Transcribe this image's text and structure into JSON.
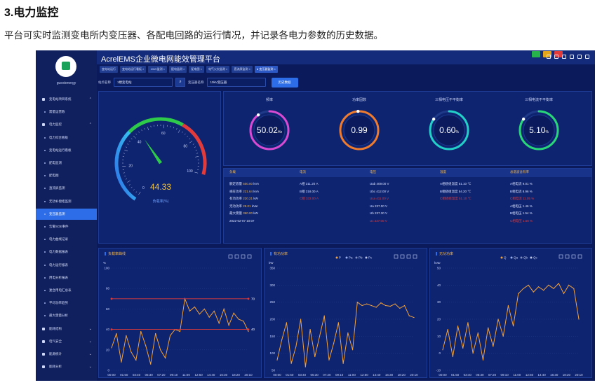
{
  "doc": {
    "title": "3.电力监控",
    "description": "平台可实时监测变电所内变压器、各配电回路的运行情况，并记录各电力参数的历史数据。"
  },
  "app": {
    "title": "AcrelEMS企业微电网能效管理平台",
    "user": "guestenergy"
  },
  "sidebar": [
    {
      "label": "变电站项目系统",
      "level": 1,
      "chevron": "⌃"
    },
    {
      "label": "需量运营数",
      "level": 2
    },
    {
      "label": "电力监控",
      "level": 1,
      "chevron": "⌃"
    },
    {
      "label": "电力综合看板",
      "level": 2
    },
    {
      "label": "变电站运行看板",
      "level": 2
    },
    {
      "label": "配电监测",
      "level": 2
    },
    {
      "label": "配电图",
      "level": 2
    },
    {
      "label": "直流屏监测",
      "level": 2
    },
    {
      "label": "无功补偿柜监测",
      "level": 2
    },
    {
      "label": "变压器监测",
      "level": 2,
      "active": true
    },
    {
      "label": "告警SOE事件",
      "level": 2
    },
    {
      "label": "电力曲线记录",
      "level": 2
    },
    {
      "label": "电力数据报表",
      "level": 2
    },
    {
      "label": "电力运行报表",
      "level": 2
    },
    {
      "label": "用电分析报表",
      "level": 2
    },
    {
      "label": "复合用电汇总表",
      "level": 2
    },
    {
      "label": "平均功率趋势",
      "level": 2
    },
    {
      "label": "最大需量分析",
      "level": 2
    },
    {
      "label": "能耗结构",
      "level": 1,
      "chevron": "⌄"
    },
    {
      "label": "电气安全",
      "level": 1,
      "chevron": "⌄"
    },
    {
      "label": "能源统计",
      "level": 1,
      "chevron": "⌄"
    },
    {
      "label": "能耗分析",
      "level": 1,
      "chevron": "⌄"
    }
  ],
  "tabs": [
    "变电站运行",
    "变电站运行看板 ×",
    "10kV监测 ×",
    "配电监测 ×",
    "配电图 ×",
    "电气火灾监测 ×",
    "直流屏监测 ×",
    "● 变压器监测 ×"
  ],
  "filter": {
    "station_label": "站点名称",
    "station_value": "1楼变电站",
    "transformer_label": "变压器名称",
    "transformer_value": "10kV变压器",
    "query_button": "历史数据"
  },
  "gauge": {
    "value": "44.33",
    "percent": 44.33,
    "label": "负载率(%)",
    "ticks": [
      "0",
      "20",
      "40",
      "60",
      "80",
      "100"
    ]
  },
  "rings": [
    {
      "title": "频率",
      "value": "50.02",
      "unit": "Hz",
      "fraction": 0.9,
      "color": "#d94ad3"
    },
    {
      "title": "功率因数",
      "value": "0.99",
      "unit": "",
      "fraction": 0.99,
      "color": "#f07b2c"
    },
    {
      "title": "三相电压不平衡率",
      "value": "0.60",
      "unit": "%",
      "fraction": 0.85,
      "color": "#22d0c8"
    },
    {
      "title": "三相电流不平衡率",
      "value": "5.10",
      "unit": "%",
      "fraction": 0.85,
      "color": "#28d878"
    }
  ],
  "table": {
    "headers": [
      "负载",
      "电流",
      "电压",
      "温度",
      "总谐波含有率"
    ],
    "load": [
      {
        "label": "额定容量",
        "value": "500.00",
        "unit": "kVA"
      },
      {
        "label": "视在功率",
        "value": "221.64",
        "unit": "kVA"
      },
      {
        "label": "有功功率",
        "value": "220.21",
        "unit": "kW"
      },
      {
        "label": "无功功率",
        "value": "28.01",
        "unit": "kVar"
      },
      {
        "label": "最大需量",
        "value": "360.00",
        "unit": "kW"
      },
      {
        "label": "",
        "value": "2022-02-07 10:07",
        "unit": ""
      }
    ],
    "current": [
      {
        "label": "A相",
        "value": "311.20",
        "unit": "A"
      },
      {
        "label": "B相",
        "value": "318.00",
        "unit": "A"
      },
      {
        "label": "C相",
        "value": "333.00",
        "unit": "A"
      }
    ],
    "voltage": [
      {
        "label": "Uab",
        "value": "409.00",
        "unit": "V"
      },
      {
        "label": "Ubc",
        "value": "412.00",
        "unit": "V"
      },
      {
        "label": "Uca",
        "value": "411.00",
        "unit": "V"
      },
      {
        "label": "Ua",
        "value": "237.00",
        "unit": "V"
      },
      {
        "label": "Ub",
        "value": "237.30",
        "unit": "V"
      },
      {
        "label": "Uc",
        "value": "237.00",
        "unit": "V"
      }
    ],
    "temperature": [
      {
        "label": "A相绕组温度",
        "value": "51.10",
        "unit": "℃"
      },
      {
        "label": "B相绕组温度",
        "value": "54.20",
        "unit": "℃"
      },
      {
        "label": "C相绕组温度",
        "value": "51.10",
        "unit": "℃"
      }
    ],
    "harmonics": [
      {
        "label": "A相电流",
        "value": "9.01",
        "unit": "%"
      },
      {
        "label": "B相电流",
        "value": "8.96",
        "unit": "%"
      },
      {
        "label": "C相电流",
        "value": "11.05",
        "unit": "%"
      },
      {
        "label": "A相电压",
        "value": "1.46",
        "unit": "%"
      },
      {
        "label": "B相电压",
        "value": "1.54",
        "unit": "%"
      },
      {
        "label": "C相电压",
        "value": "1.58",
        "unit": "%"
      }
    ]
  },
  "colors": {
    "line": "#f4a339",
    "alert": "#e13a3a",
    "bg": "#0b1a5a",
    "accent": "#2d6ee8"
  },
  "chart_data": [
    {
      "type": "line",
      "title": "负载率曲线",
      "ylabel": "%",
      "ylim": [
        0,
        100
      ],
      "yticks": [
        0,
        20,
        40,
        60,
        80,
        100
      ],
      "x": [
        "00:00",
        "01:50",
        "03:40",
        "05:30",
        "07:20",
        "09:10",
        "11:00",
        "12:50",
        "14:40",
        "16:30",
        "18:20",
        "20:10"
      ],
      "thresholds": [
        {
          "value": 70,
          "label": "70"
        },
        {
          "value": 40,
          "label": "40"
        }
      ],
      "series": [
        {
          "values": [
            22,
            36,
            8,
            34,
            18,
            10,
            38,
            24,
            6,
            36,
            20,
            12,
            34,
            40,
            38,
            70,
            58,
            62,
            55,
            60,
            52,
            58,
            46,
            60,
            44,
            56,
            50,
            48,
            38
          ]
        }
      ]
    },
    {
      "type": "line",
      "title": "有功功率",
      "ylabel": "kW",
      "ylim": [
        50,
        350
      ],
      "yticks": [
        50,
        100,
        150,
        200,
        250,
        300,
        350
      ],
      "x": [
        "00:00",
        "01:50",
        "03:40",
        "05:30",
        "07:20",
        "09:10",
        "11:00",
        "12:50",
        "14:40",
        "16:30",
        "18:20",
        "20:10"
      ],
      "legend": [
        "P",
        "Pa",
        "Pb",
        "Pc"
      ],
      "series": [
        {
          "values": [
            80,
            140,
            190,
            70,
            120,
            200,
            60,
            170,
            90,
            150,
            210,
            80,
            130,
            190,
            70,
            160,
            110,
            250,
            240,
            245,
            240,
            235,
            248,
            240,
            238,
            245,
            232,
            240,
            210,
            205
          ]
        }
      ]
    },
    {
      "type": "line",
      "title": "无功功率",
      "ylabel": "kVar",
      "ylim": [
        -10,
        50
      ],
      "yticks": [
        -10,
        0,
        10,
        20,
        30,
        40,
        50
      ],
      "x": [
        "00:00",
        "01:50",
        "03:40",
        "05:30",
        "07:20",
        "09:10",
        "11:00",
        "12:50",
        "14:40",
        "16:30",
        "18:20",
        "20:10"
      ],
      "legend": [
        "Q",
        "Qa",
        "Qb",
        "Qc"
      ],
      "series": [
        {
          "values": [
            2,
            14,
            -2,
            16,
            3,
            18,
            0,
            12,
            -4,
            15,
            4,
            20,
            10,
            28,
            16,
            35,
            38,
            40,
            36,
            39,
            37,
            40,
            38,
            41,
            35,
            40,
            38,
            20
          ]
        }
      ]
    }
  ]
}
